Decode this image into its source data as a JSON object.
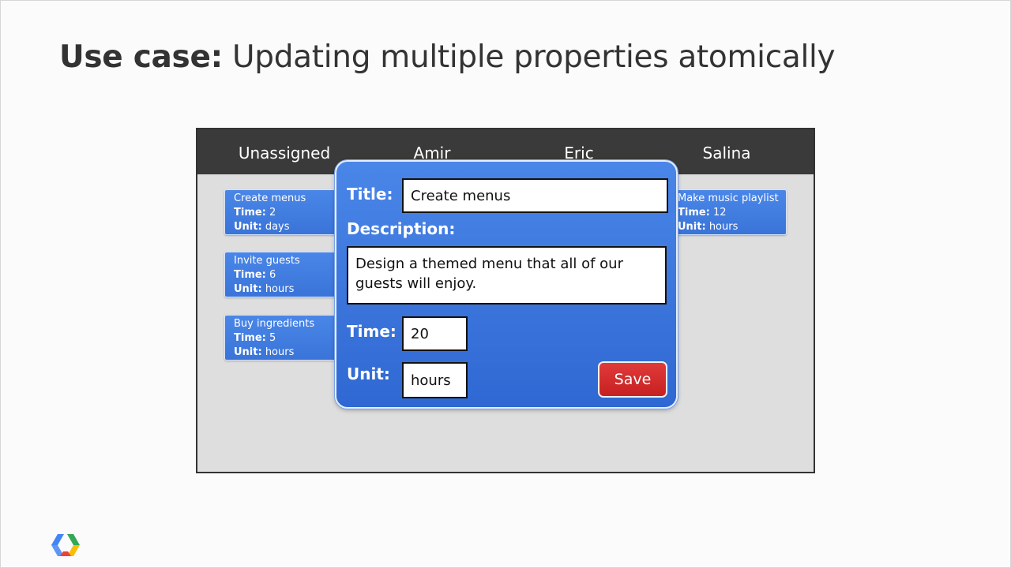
{
  "slide": {
    "title_bold": "Use case:",
    "title_rest": " Updating multiple properties atomically"
  },
  "board": {
    "columns": [
      "Unassigned",
      "Amir",
      "Eric",
      "Salina"
    ],
    "cards": [
      {
        "title": "Create menus",
        "time_label": "Time:",
        "time": " 2",
        "unit_label": "Unit:",
        "unit": " days"
      },
      {
        "title": "Invite guests",
        "time_label": "Time:",
        "time": " 6",
        "unit_label": "Unit:",
        "unit": " hours"
      },
      {
        "title": "Buy ingredients",
        "time_label": "Time:",
        "time": " 5",
        "unit_label": "Unit:",
        "unit": " hours"
      },
      {
        "title": "Make music playlist",
        "time_label": "Time:",
        "time": " 12",
        "unit_label": "Unit:",
        "unit": " hours"
      }
    ]
  },
  "modal": {
    "title_label": "Title:",
    "title_value": "Create menus",
    "description_label": "Description:",
    "description_value": "Design a themed menu that all of our guests will enjoy.",
    "time_label": "Time:",
    "time_value": "20",
    "unit_label": "Unit:",
    "unit_value": "hours",
    "save_label": "Save"
  },
  "colors": {
    "card_blue": "#4a86e8",
    "header_dark": "#3a3a3a",
    "save_red": "#d32f2f"
  },
  "icons": {
    "logo": "google-cloud-platform-logo-icon"
  }
}
